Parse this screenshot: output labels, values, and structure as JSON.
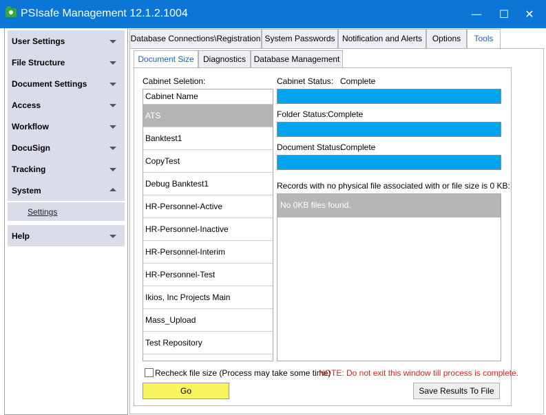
{
  "window": {
    "title": "PSIsafe Management 12.1.2.1004",
    "minimize": "—",
    "maximize": "☐",
    "close": "✕"
  },
  "sidebar": {
    "sections": [
      {
        "label": "User Settings"
      },
      {
        "label": "File Structure"
      },
      {
        "label": "Document Settings"
      },
      {
        "label": "Access"
      },
      {
        "label": "Workflow"
      },
      {
        "label": "DocuSign"
      },
      {
        "label": "Tracking"
      },
      {
        "label": "System",
        "expanded": true
      },
      {
        "label": "Help"
      }
    ],
    "system_items": [
      "Settings"
    ]
  },
  "main_tabs": [
    {
      "label": "Database Connections\\Registration"
    },
    {
      "label": "System Passwords"
    },
    {
      "label": "Notification and Alerts"
    },
    {
      "label": "Options"
    },
    {
      "label": "Tools",
      "active": true
    }
  ],
  "sub_tabs": [
    {
      "label": "Document Size",
      "active": true
    },
    {
      "label": "Diagnostics"
    },
    {
      "label": "Database Management"
    }
  ],
  "document_size": {
    "cabinet_selection_label": "Cabinet Seletion:",
    "cabinet_header": "Cabinet Name",
    "cabinets": [
      "ATS",
      "Banktest1",
      "CopyTest",
      "Debug Banktest1",
      "HR-Personnel-Active",
      "HR-Personnel-Inactive",
      "HR-Personnel-Interim",
      "HR-Personnel-Test",
      "Ikios, Inc Projects Main",
      "Mass_Upload",
      "Test Repository"
    ],
    "selected_cabinet": "ATS",
    "cabinet_status_label": "Cabinet Status:",
    "cabinet_status_value": "Complete",
    "cabinet_progress": 1.0,
    "folder_status_label": "Folder Status:",
    "folder_status_value": "Complete",
    "folder_progress": 1.0,
    "document_status_label": "Document Status:",
    "document_status_value": "Complete",
    "document_progress": 1.0,
    "records_label": "Records with no physical file associated with or file size is 0 KB:",
    "records_message": "No 0KB files found.",
    "recheck_label": "Recheck file size (Process may take some time)",
    "recheck_checked": false,
    "note": "NOTE: Do not exit this window till process is complete.",
    "go_button": "Go",
    "save_button": "Save Results To File"
  },
  "colors": {
    "titlebar": "#0b76d6",
    "progress": "#00a3ee",
    "note": "#e0201b",
    "go_button": "#f7f45e",
    "sidebar_section": "#dadcea",
    "active_tab_text": "#1a63b8"
  }
}
